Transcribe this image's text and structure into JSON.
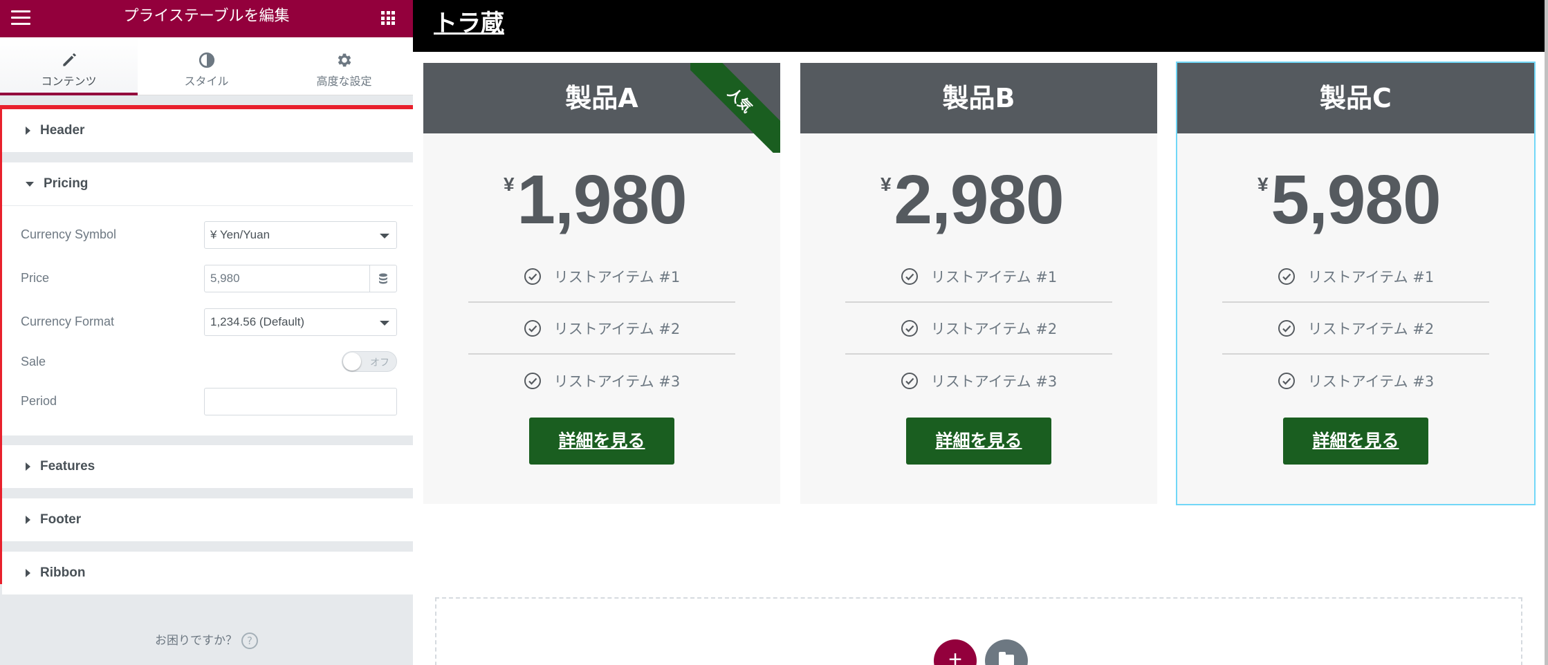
{
  "panel": {
    "title": "プライステーブルを編集",
    "tabs": [
      {
        "label": "コンテンツ",
        "icon": "pencil-icon",
        "active": true
      },
      {
        "label": "スタイル",
        "icon": "half-circle-icon",
        "active": false
      },
      {
        "label": "高度な設定",
        "icon": "gear-icon",
        "active": false
      }
    ],
    "sections": {
      "header": "Header",
      "pricing": "Pricing",
      "features": "Features",
      "footer": "Footer",
      "ribbon": "Ribbon"
    },
    "pricing": {
      "currency_symbol_label": "Currency Symbol",
      "currency_symbol_value": "¥ Yen/Yuan",
      "price_label": "Price",
      "price_value": "5,980",
      "currency_format_label": "Currency Format",
      "currency_format_value": "1,234.56 (Default)",
      "sale_label": "Sale",
      "sale_toggle": "オフ",
      "period_label": "Period",
      "period_value": ""
    },
    "help_text": "お困りですか？",
    "help_icon": "?"
  },
  "site": {
    "title": "トラ蔵"
  },
  "cards": [
    {
      "title": "製品A",
      "currency": "¥",
      "price": "1,980",
      "ribbon": "人気",
      "features": [
        "リストアイテム #1",
        "リストアイテム #2",
        "リストアイテム #3"
      ],
      "button": "詳細を見る"
    },
    {
      "title": "製品B",
      "currency": "¥",
      "price": "2,980",
      "features": [
        "リストアイテム #1",
        "リストアイテム #2",
        "リストアイテム #3"
      ],
      "button": "詳細を見る"
    },
    {
      "title": "製品C",
      "currency": "¥",
      "price": "5,980",
      "features": [
        "リストアイテム #1",
        "リストアイテム #2",
        "リストアイテム #3"
      ],
      "button": "詳細を見る"
    }
  ],
  "add_section": {
    "add_icon": "+",
    "template_icon": "folder-icon"
  },
  "colors": {
    "brand": "#93003c",
    "card_header": "#555a5f",
    "cta": "#1a5e20",
    "highlight_border": "#e8202c"
  }
}
